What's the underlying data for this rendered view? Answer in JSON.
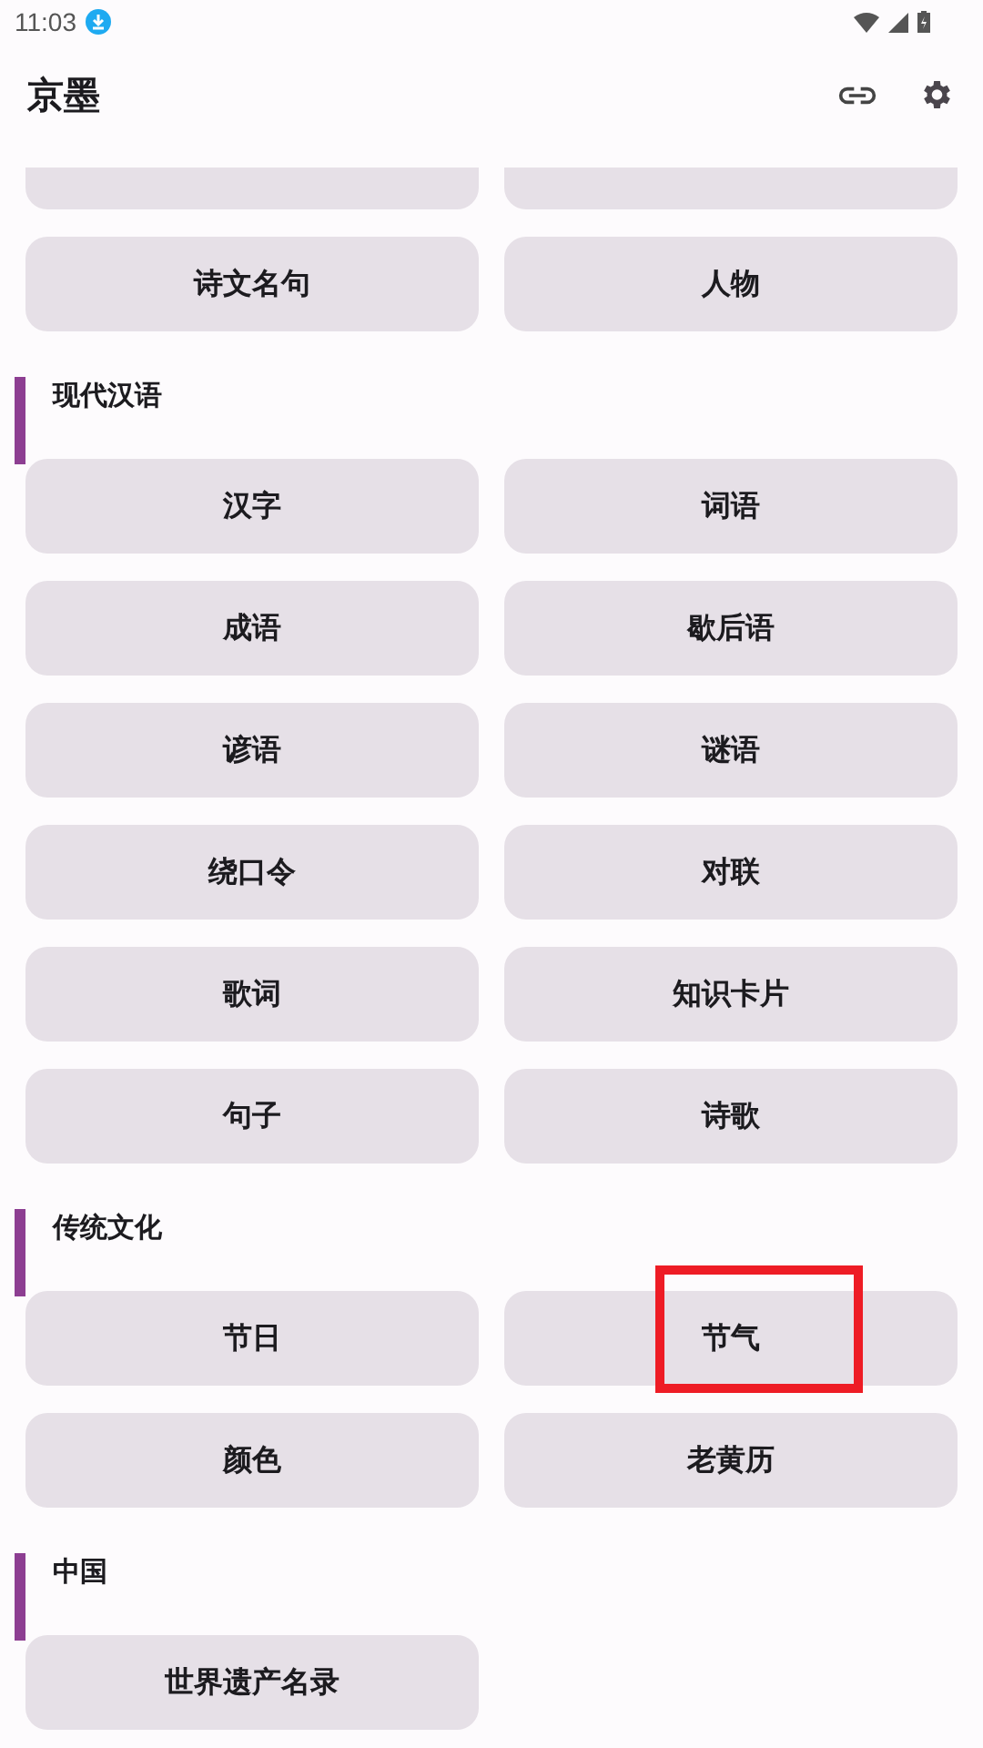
{
  "status_bar": {
    "time": "11:03"
  },
  "app_bar": {
    "title": "京墨"
  },
  "clipped_row": [
    {
      "kind": "button"
    },
    {
      "kind": "button"
    }
  ],
  "sections": [
    {
      "items": [
        {
          "label": "诗文名句",
          "highlighted": false
        },
        {
          "label": "人物",
          "highlighted": false
        }
      ]
    },
    {
      "title": "现代汉语",
      "items": [
        {
          "label": "汉字",
          "highlighted": false
        },
        {
          "label": "词语",
          "highlighted": false
        },
        {
          "label": "成语",
          "highlighted": false
        },
        {
          "label": "歇后语",
          "highlighted": false
        },
        {
          "label": "谚语",
          "highlighted": false
        },
        {
          "label": "谜语",
          "highlighted": false
        },
        {
          "label": "绕口令",
          "highlighted": false
        },
        {
          "label": "对联",
          "highlighted": false
        },
        {
          "label": "歌词",
          "highlighted": false
        },
        {
          "label": "知识卡片",
          "highlighted": false
        },
        {
          "label": "句子",
          "highlighted": false
        },
        {
          "label": "诗歌",
          "highlighted": false
        }
      ]
    },
    {
      "title": "传统文化",
      "items": [
        {
          "label": "节日",
          "highlighted": false
        },
        {
          "label": "节气",
          "highlighted": true
        },
        {
          "label": "颜色",
          "highlighted": false
        },
        {
          "label": "老黄历",
          "highlighted": false
        }
      ]
    },
    {
      "title": "中国",
      "items": [
        {
          "label": "世界遗产名录",
          "highlighted": false
        }
      ]
    }
  ]
}
